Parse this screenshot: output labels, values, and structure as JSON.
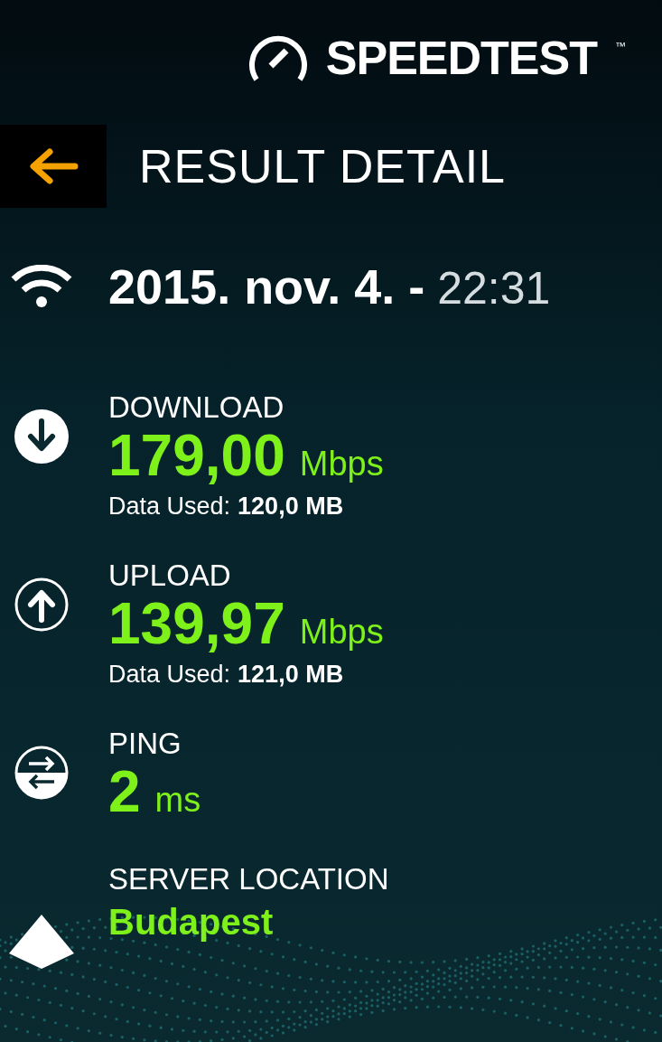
{
  "logo": {
    "text": "SPEEDTEST",
    "trademark": "™"
  },
  "header": {
    "title": "RESULT DETAIL"
  },
  "result": {
    "date": "2015. nov. 4. -",
    "time": "22:31"
  },
  "metrics": [
    {
      "kind": "download",
      "label": "DOWNLOAD",
      "value": "179,00",
      "unit": "Mbps",
      "data_used_label": "Data Used:",
      "data_used": "120,0 MB"
    },
    {
      "kind": "upload",
      "label": "UPLOAD",
      "value": "139,97",
      "unit": "Mbps",
      "data_used_label": "Data Used:",
      "data_used": "121,0 MB"
    },
    {
      "kind": "ping",
      "label": "PING",
      "value": "2",
      "unit": "ms"
    },
    {
      "kind": "server",
      "label": "SERVER LOCATION",
      "value": "Budapest"
    }
  ]
}
